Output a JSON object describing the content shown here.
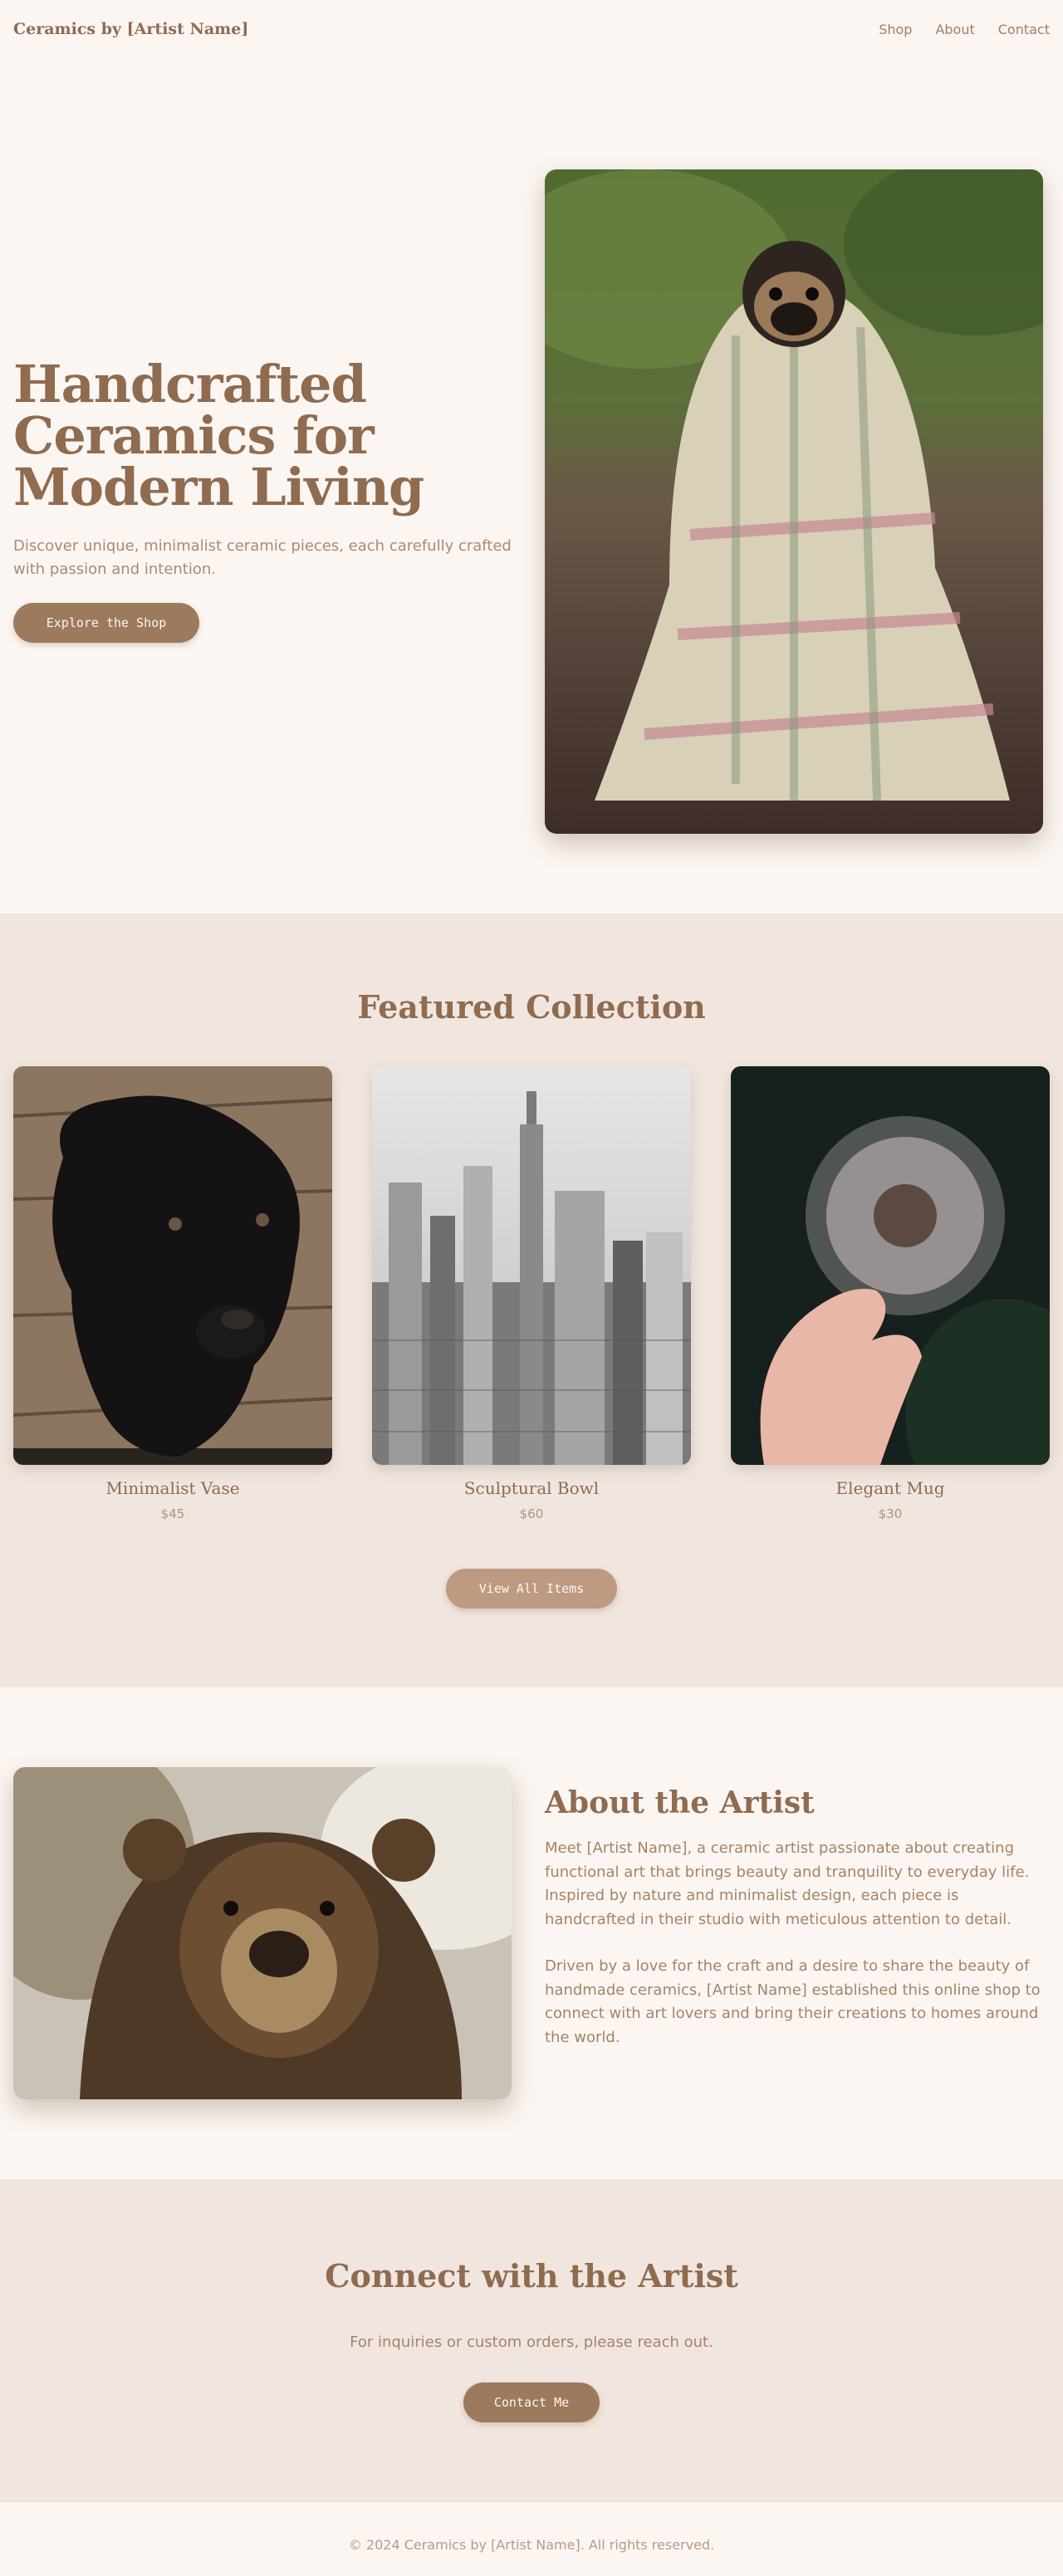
{
  "header": {
    "logo": "Ceramics by [Artist Name]",
    "nav": [
      "Shop",
      "About",
      "Contact"
    ]
  },
  "hero": {
    "title": "Handcrafted Ceramics for Modern Living",
    "subtitle": "Discover unique, minimalist ceramic pieces, each carefully crafted with passion and intention.",
    "cta": "Explore the Shop",
    "image": "pug-wrapped-in-blanket"
  },
  "featured": {
    "title": "Featured Collection",
    "products": [
      {
        "name": "Minimalist Vase",
        "price": "$45",
        "image": "black-puppy"
      },
      {
        "name": "Sculptural Bowl",
        "price": "$60",
        "image": "city-skyline"
      },
      {
        "name": "Elegant Mug",
        "price": "$30",
        "image": "dandelion-in-hand"
      }
    ],
    "cta": "View All Items"
  },
  "about": {
    "title": "About the Artist",
    "paragraphs": [
      "Meet [Artist Name], a ceramic artist passionate about creating functional art that brings beauty and tranquility to everyday life. Inspired by nature and minimalist design, each piece is handcrafted in their studio with meticulous attention to detail.",
      "Driven by a love for the craft and a desire to share the beauty of handmade ceramics, [Artist Name] established this online shop to connect with art lovers and bring their creations to homes around the world."
    ],
    "image": "brown-bear"
  },
  "contact": {
    "title": "Connect with the Artist",
    "subtitle": "For inquiries or custom orders, please reach out.",
    "cta": "Contact Me"
  },
  "footer": {
    "copyright": "© 2024 Ceramics by [Artist Name]. All rights reserved."
  },
  "colors": {
    "background": "#fcf6f2",
    "band": "#f1e6df",
    "accent": "#9c7a5e",
    "heading": "#8f6b50"
  }
}
